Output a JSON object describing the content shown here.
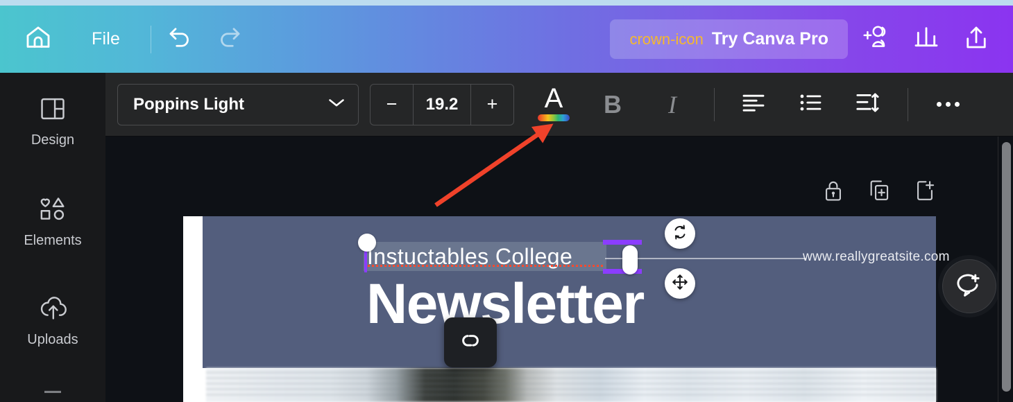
{
  "header": {
    "home_icon": "home-icon",
    "file_label": "File",
    "undo_icon": "undo-arrow-icon",
    "redo_icon": "redo-arrow-icon",
    "pro_crown_icon": "crown-icon",
    "pro_label": "Try Canva Pro",
    "share_people_icon": "add-collaborator-icon",
    "insights_icon": "bar-chart-icon",
    "export_icon": "upload-share-icon"
  },
  "sidebar": {
    "items": [
      {
        "label": "Design",
        "icon": "layout-template-icon"
      },
      {
        "label": "Elements",
        "icon": "shapes-icon"
      },
      {
        "label": "Uploads",
        "icon": "cloud-upload-icon"
      },
      {
        "label": "",
        "icon": "partial-icon"
      }
    ]
  },
  "toolbar": {
    "font_family": "Poppins Light",
    "font_dropdown_icon": "chevron-down-icon",
    "size_decrease": "−",
    "font_size": "19.2",
    "size_increase": "+",
    "text_color_glyph": "A",
    "text_color_icon": "text-color-icon",
    "bold_label": "B",
    "italic_label": "I",
    "align_icon": "align-left-icon",
    "list_icon": "bulleted-list-icon",
    "spacing_icon": "line-spacing-icon",
    "more_icon": "more-options-icon"
  },
  "page_tools": {
    "lock_icon": "lock-icon",
    "duplicate_icon": "duplicate-page-icon",
    "add_page_icon": "add-page-icon"
  },
  "canvas": {
    "website_text": "www.reallygreatsite.com",
    "headline": "Newsletter",
    "selected_text": "Instuctables College",
    "rotate_icon": "rotate-handle-icon",
    "move_icon": "move-handle-icon",
    "link_icon": "link-icon",
    "band_color": "#535e7d",
    "selection_accent": "#8b3dff",
    "spellcheck_color": "#ff4a2e"
  },
  "comment": {
    "icon": "add-comment-icon"
  },
  "scrollbar": {
    "name": "vertical-scrollbar"
  },
  "annotation": {
    "arrow_color": "#f0422a",
    "points_to": "text-color-button"
  }
}
